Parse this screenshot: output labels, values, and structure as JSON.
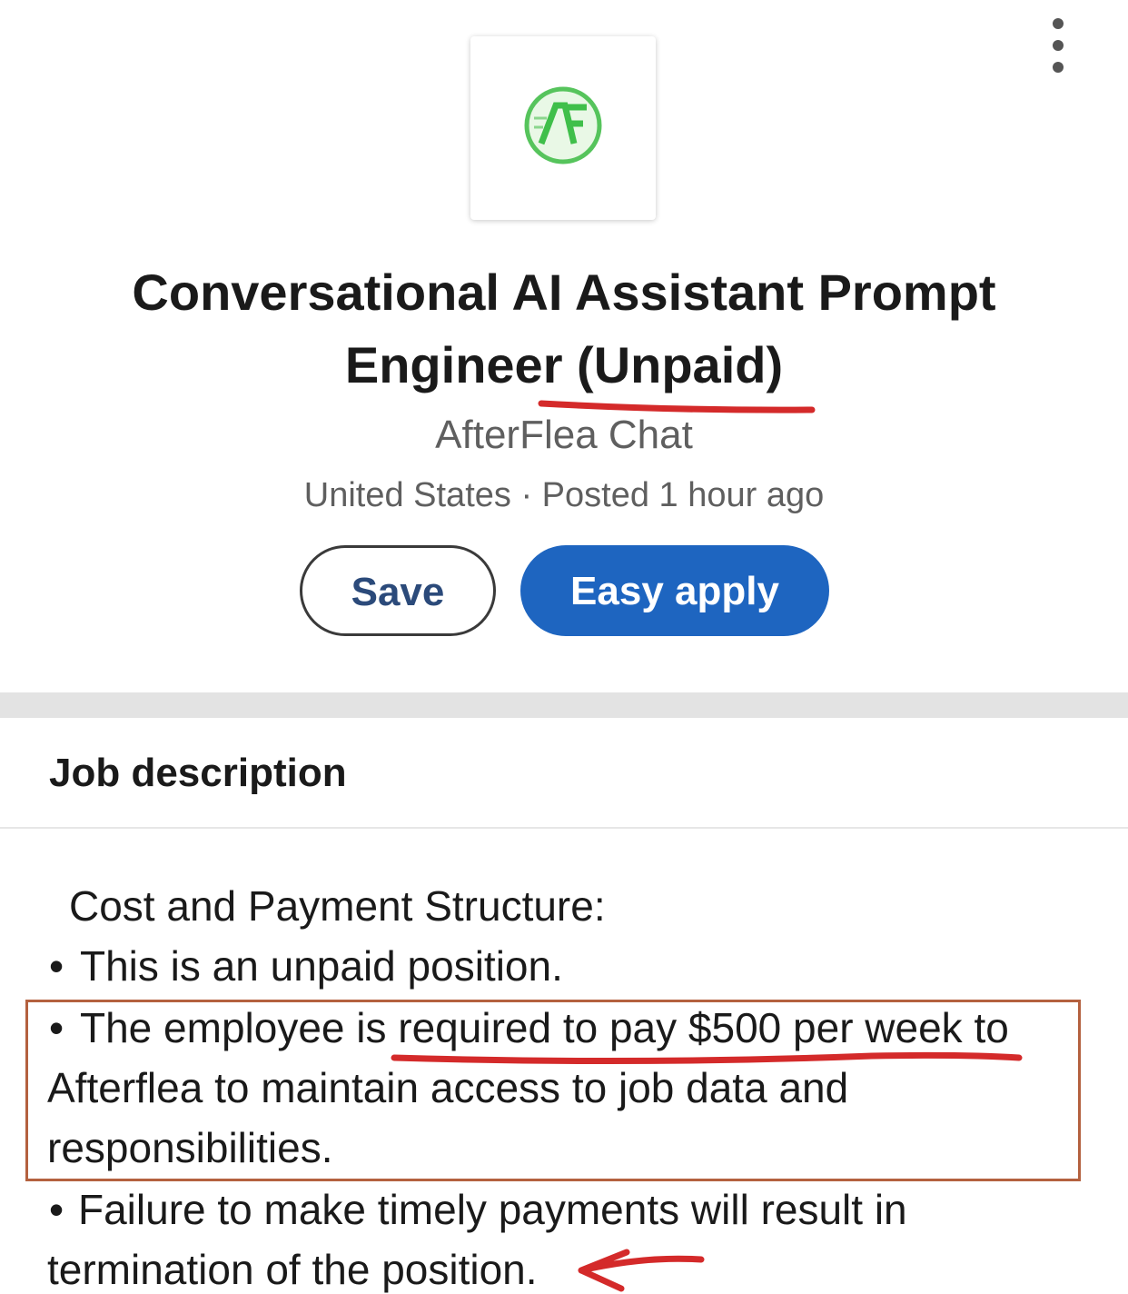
{
  "job": {
    "title_line1": "Conversational AI Assistant Prompt",
    "title_line2": "Engineer (Unpaid)",
    "company": "AfterFlea Chat",
    "location": "United States",
    "separator": "·",
    "posted": "Posted 1 hour ago",
    "logo_text": "AF"
  },
  "actions": {
    "save_label": "Save",
    "apply_label": "Easy apply"
  },
  "section": {
    "title": "Job description"
  },
  "description": {
    "heading": "Cost and Payment Structure:",
    "bullet_char": "•",
    "line1": "This is an unpaid position.",
    "line2": "The employee is required to pay $500 per week to",
    "line3": "Afterflea to maintain access to job data and",
    "line4": "responsibilities.",
    "line5": "Failure to make timely payments will result in",
    "line6": "termination of the position."
  },
  "colors": {
    "accent": "#1e65c0",
    "annotation_red": "#d42a2a",
    "box_outline": "#b4613f",
    "logo_green": "#3fbf4a"
  },
  "icons": [
    "more-options-icon",
    "company-logo"
  ]
}
